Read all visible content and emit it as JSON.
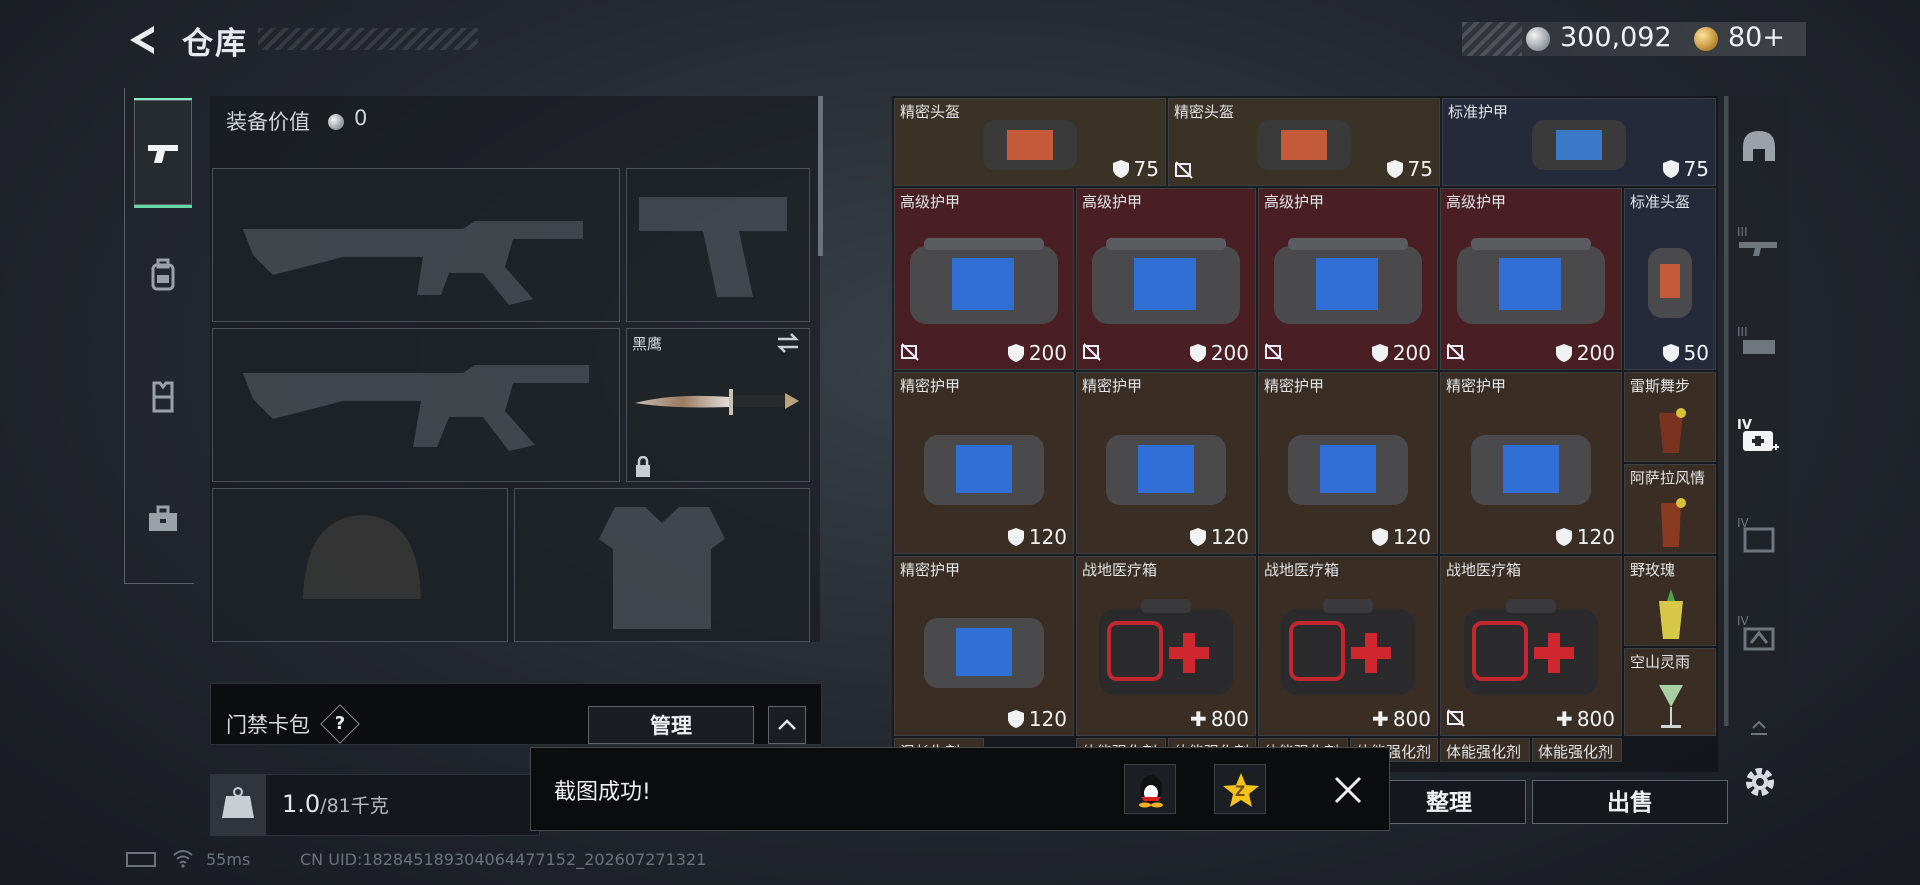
{
  "header": {
    "title": "仓库",
    "currency_silver": "300,092",
    "currency_gold": "80+"
  },
  "categories": [
    {
      "icon": "pistol-icon",
      "active": true
    },
    {
      "icon": "backpack-icon",
      "active": false
    },
    {
      "icon": "chest-rig-icon",
      "active": false
    },
    {
      "icon": "toolbox-icon",
      "active": false
    }
  ],
  "loadout": {
    "equip_value_label": "装备价值",
    "equip_value": "0",
    "melee_name": "黑鹰"
  },
  "keycard": {
    "label": "门禁卡包",
    "help": "?",
    "manage_label": "管理"
  },
  "weight": {
    "current": "1.0",
    "max": "/81千克",
    "icon_text": "KG"
  },
  "footer": {
    "ping": "55ms",
    "uid": "CN UID:18284518930406447715​2_202607271321"
  },
  "inventory": {
    "row1": [
      {
        "name": "精密头盔",
        "value": "75",
        "kind": "helmet"
      },
      {
        "name": "精密头盔",
        "value": "75",
        "kind": "helmet",
        "no_insure": true
      },
      {
        "name": "标准护甲",
        "value": "75",
        "kind": "armor_small"
      }
    ],
    "row2": [
      {
        "name": "高级护甲",
        "value": "200"
      },
      {
        "name": "高级护甲",
        "value": "200"
      },
      {
        "name": "高级护甲",
        "value": "200"
      },
      {
        "name": "高级护甲",
        "value": "200"
      },
      {
        "name": "标准头盔",
        "value": "50"
      }
    ],
    "row3": [
      {
        "name": "精密护甲",
        "value": "120"
      },
      {
        "name": "精密护甲",
        "value": "120"
      },
      {
        "name": "精密护甲",
        "value": "120"
      },
      {
        "name": "精密护甲",
        "value": "120"
      }
    ],
    "row4": [
      {
        "name": "精密护甲",
        "value": "120"
      },
      {
        "name": "战地医疗箱",
        "value": "800"
      },
      {
        "name": "战地医疗箱",
        "value": "800"
      },
      {
        "name": "战地医疗箱",
        "value": "800"
      }
    ],
    "drinks": [
      {
        "name": "雷斯舞步"
      },
      {
        "name": "阿萨拉风情"
      },
      {
        "name": "野玫瑰"
      },
      {
        "name": "空山灵雨"
      }
    ],
    "row5": [
      {
        "name": "混长生剂"
      },
      {
        "name": "体能强化剂"
      },
      {
        "name": "体能强化剂"
      },
      {
        "name": "体能强化剂"
      },
      {
        "name": "体能强化剂"
      },
      {
        "name": "体能强化剂"
      },
      {
        "name": "体能强化剂"
      }
    ]
  },
  "filters": [
    {
      "icon": "helmet-filter-icon"
    },
    {
      "icon": "tier3-rifle-icon"
    },
    {
      "icon": "tier3-ammo-icon"
    },
    {
      "icon": "tier4-medkit-icon",
      "active": true
    },
    {
      "icon": "tier4-gear-icon"
    },
    {
      "icon": "tier4-case-icon"
    },
    {
      "icon": "upload-icon"
    }
  ],
  "actions": {
    "sort_label": "整理",
    "sell_label": "出售"
  },
  "toast": {
    "message": "截图成功!"
  },
  "colors": {
    "accent_green": "#67d8a7",
    "cell_gold": "#3b3226",
    "cell_red": "#4a1f24",
    "cell_blue": "#252a3b",
    "cell_brown": "#3a2e24"
  }
}
